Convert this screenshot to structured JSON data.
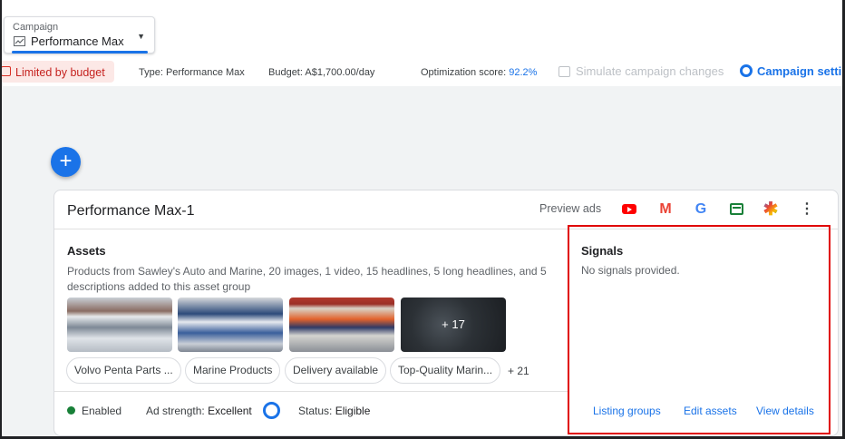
{
  "campaign_select": {
    "label": "Campaign",
    "value": "Performance Max",
    "icon": "trend-chart-icon"
  },
  "status_bar": {
    "limited": "Limited by budget",
    "type": "Type: Performance Max",
    "budget": "Budget: A$1,700.00/day",
    "optimization_label": "Optimization score: ",
    "optimization_value": "92.2%",
    "simulate": "Simulate campaign changes",
    "settings": "Campaign setting"
  },
  "fab": {
    "label": "+"
  },
  "asset_group": {
    "title": "Performance Max-1",
    "preview_label": "Preview ads",
    "channels": [
      "youtube-icon",
      "gmail-icon",
      "google-icon",
      "display-icon",
      "discover-icon"
    ],
    "more_label": "⋮",
    "assets": {
      "title": "Assets",
      "description": "Products from Sawley's Auto and Marine, 20 images, 1 video, 15 headlines, 5 long headlines, and 5 descriptions added to this asset group",
      "thumb_more": "+ 17",
      "chips": [
        "Volvo Penta Parts ...",
        "Marine Products",
        "Delivery available",
        "Top-Quality Marin..."
      ],
      "chips_more": "+ 21"
    },
    "footer": {
      "enabled": "Enabled",
      "ad_strength_label": "Ad strength:",
      "ad_strength_value": "Excellent",
      "status_label": "Status:",
      "status_value": "Eligible"
    },
    "signals": {
      "title": "Signals",
      "text": "No signals provided.",
      "links": [
        "Listing groups",
        "Edit assets",
        "View details"
      ]
    }
  },
  "colors": {
    "accent": "#1a73e8",
    "warning": "#c5221f",
    "enabled": "#188038",
    "highlight": "#e00000"
  }
}
